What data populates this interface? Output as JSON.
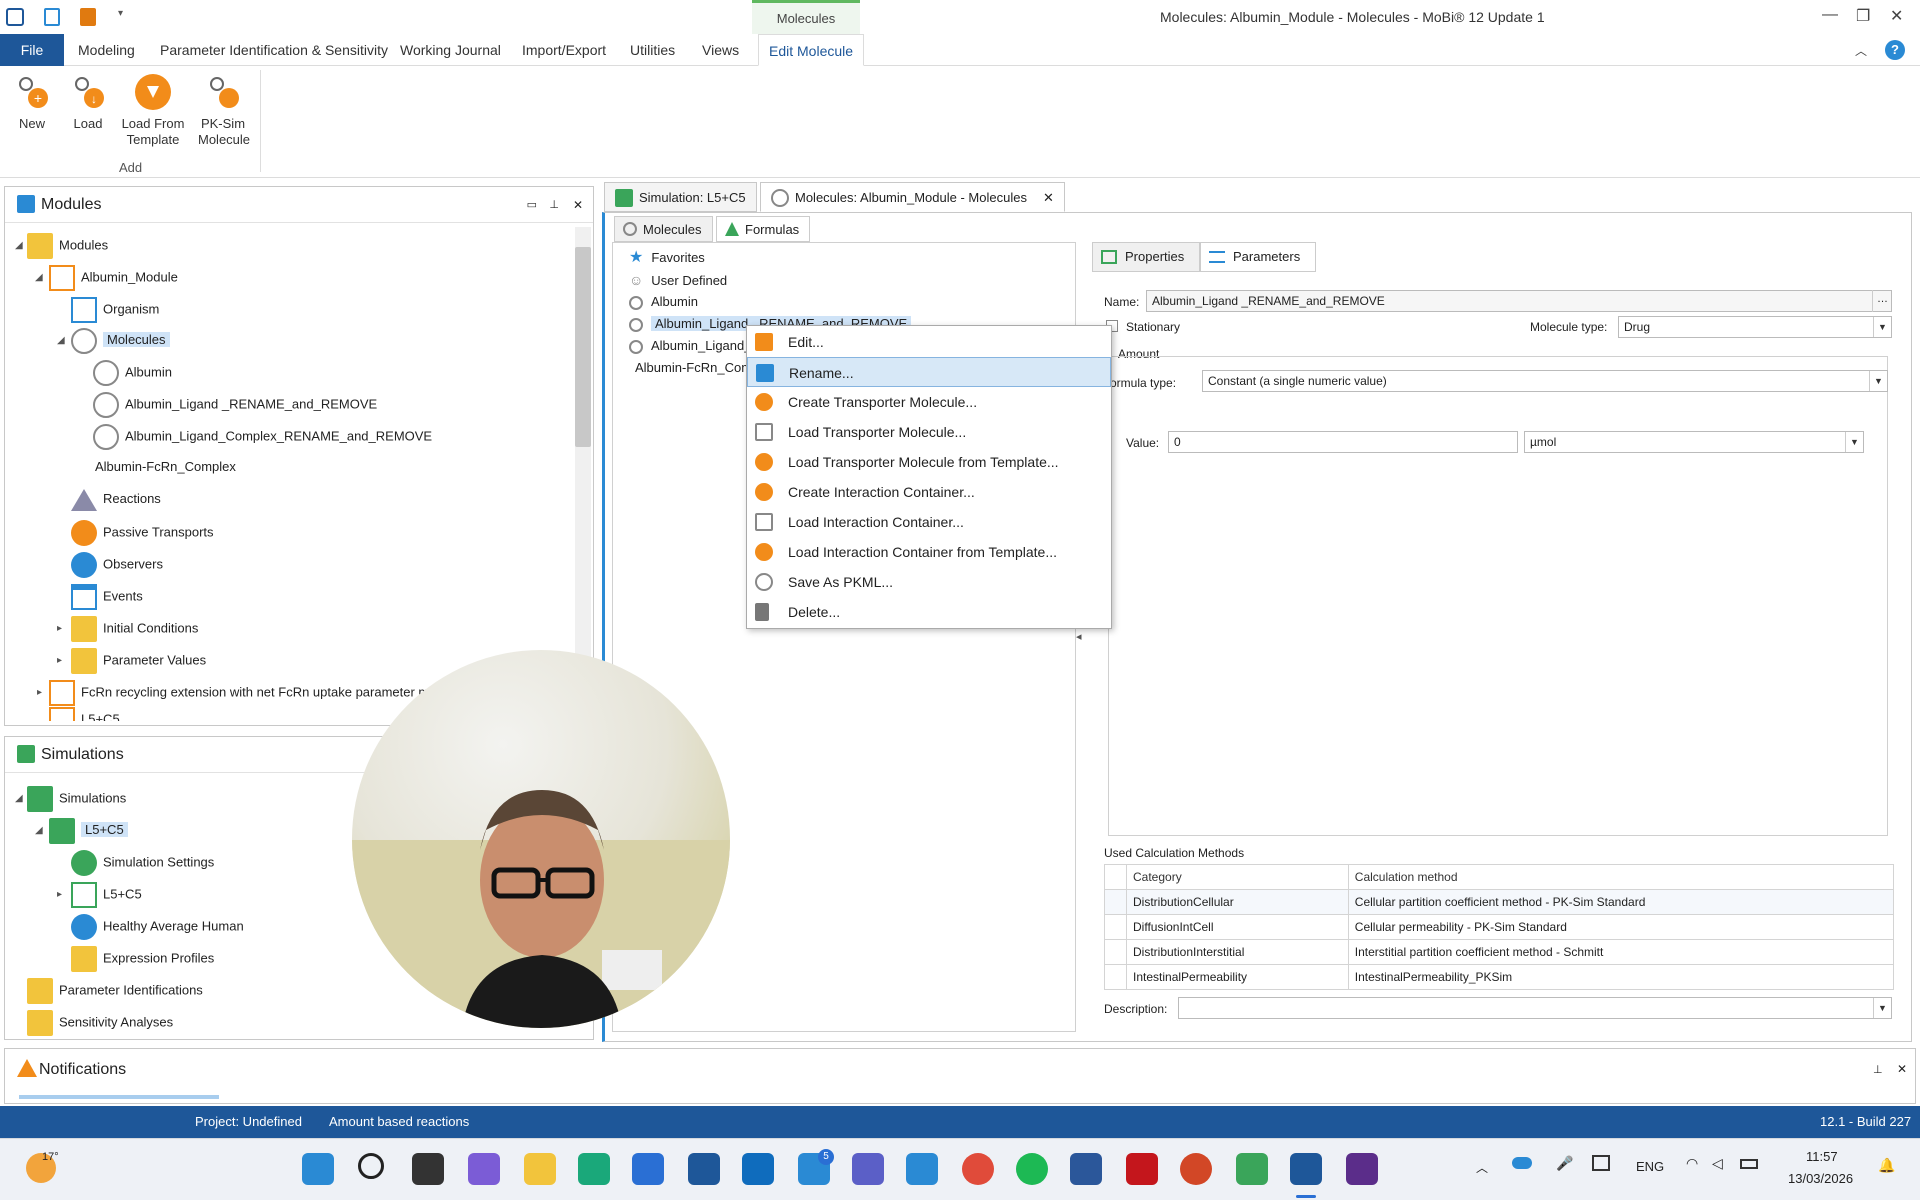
{
  "window": {
    "title": "Molecules: Albumin_Module - Molecules - MoBi® 12 Update 1",
    "context_tab": "Molecules"
  },
  "menu": [
    "File",
    "Modeling",
    "Parameter Identification & Sensitivity",
    "Working Journal",
    "Import/Export",
    "Utilities",
    "Views",
    "Edit Molecule"
  ],
  "ribbon": {
    "buttons": [
      "New",
      "Load",
      "Load From Template",
      "PK-Sim Molecule"
    ],
    "group_label": "Add"
  },
  "modules_panel": {
    "title": "Modules",
    "items": [
      "Modules",
      "Albumin_Module",
      "Organism",
      "Molecules",
      "Albumin",
      "Albumin_Ligand _RENAME_and_REMOVE",
      "Albumin_Ligand_Complex_RENAME_and_REMOVE",
      "Albumin-FcRn_Complex",
      "Reactions",
      "Passive Transports",
      "Observers",
      "Events",
      "Initial Conditions",
      "Parameter Values",
      "FcRn recycling extension with net FcRn uptake parameter mi",
      "L5+C5"
    ]
  },
  "simulations_panel": {
    "title": "Simulations",
    "items": [
      "Simulations",
      "L5+C5",
      "Simulation Settings",
      "L5+C5",
      "Healthy Average Human",
      "Expression Profiles",
      "Parameter Identifications",
      "Sensitivity Analyses"
    ]
  },
  "doc_tabs": [
    "Simulation: L5+C5",
    "Molecules: Albumin_Module - Molecules"
  ],
  "sub_tabs": [
    "Molecules",
    "Formulas"
  ],
  "molecule_list": [
    "Favorites",
    "User Defined",
    "Albumin",
    "Albumin_Ligand _RENAME_and_REMOVE",
    "Albumin_Ligand_",
    "Albumin-FcRn_Com"
  ],
  "context_menu": [
    "Edit...",
    "Rename...",
    "Create Transporter Molecule...",
    "Load Transporter Molecule...",
    "Load Transporter Molecule from Template...",
    "Create Interaction Container...",
    "Load Interaction Container...",
    "Load Interaction Container from Template...",
    "Save As PKML...",
    "Delete..."
  ],
  "props": {
    "tabs": [
      "Properties",
      "Parameters"
    ],
    "name_label": "Name:",
    "name_value": "Albumin_Ligand _RENAME_and_REMOVE",
    "stationary_label": "Stationary",
    "molecule_type_label": "Molecule type:",
    "molecule_type_value": "Drug",
    "amount_label": "Amount",
    "formula_type_label": "ormula type:",
    "formula_type_value": "Constant (a single numeric value)",
    "value_label": "Value:",
    "value_value": "0",
    "unit_value": "µmol",
    "calc_methods_label": "Used Calculation Methods",
    "calc_headers": [
      "Category",
      "Calculation method"
    ],
    "calc_rows": [
      [
        "DistributionCellular",
        "Cellular partition coefficient method - PK-Sim Standard"
      ],
      [
        "DiffusionIntCell",
        "Cellular permeability - PK-Sim Standard"
      ],
      [
        "DistributionInterstitial",
        "Interstitial partition coefficient method - Schmitt"
      ],
      [
        "IntestinalPermeability",
        "IntestinalPermeability_PKSim"
      ]
    ],
    "description_label": "Description:"
  },
  "notifications": {
    "title": "Notifications"
  },
  "status": {
    "project": "Project: Undefined",
    "mode": "Amount based reactions",
    "build": "12.1 - Build 227"
  },
  "taskbar": {
    "weather": "17°",
    "lang": "ENG",
    "time": "11:57",
    "date": "13/03/2026",
    "badge_todo": "5"
  }
}
